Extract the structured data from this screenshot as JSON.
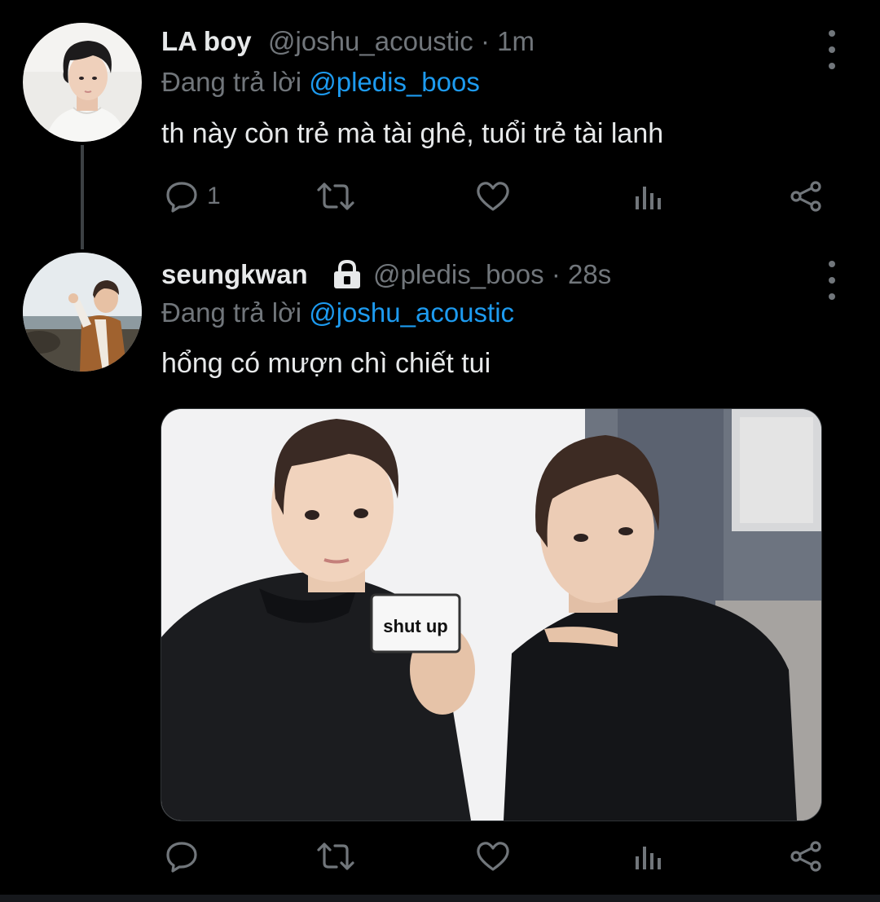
{
  "tweets": [
    {
      "display_name": "LA boy",
      "handle": "@joshu_acoustic",
      "separator": "·",
      "time": "1m",
      "reply_prefix": "Đang trả lời",
      "reply_to": "@pledis_boos",
      "text": "th này còn trẻ mà tài ghê, tuổi trẻ tài lanh",
      "reply_count": "1",
      "avatar_icon": "profile-photo"
    },
    {
      "display_name": "seungkwan",
      "protected_icon": "lock-icon",
      "handle": "@pledis_boos",
      "separator": "·",
      "time": "28s",
      "reply_prefix": "Đang trả lời",
      "reply_to": "@joshu_acoustic",
      "text": "hổng có mượn chì chiết tui",
      "media_caption": "shut up",
      "avatar_icon": "profile-photo"
    }
  ],
  "icons": {
    "reply": "reply-icon",
    "retweet": "retweet-icon",
    "like": "heart-icon",
    "views": "analytics-icon",
    "share": "share-icon",
    "more": "more-icon"
  },
  "colors": {
    "background": "#000000",
    "text": "#e7e9ea",
    "secondary": "#71767b",
    "link": "#1d9bf0"
  }
}
